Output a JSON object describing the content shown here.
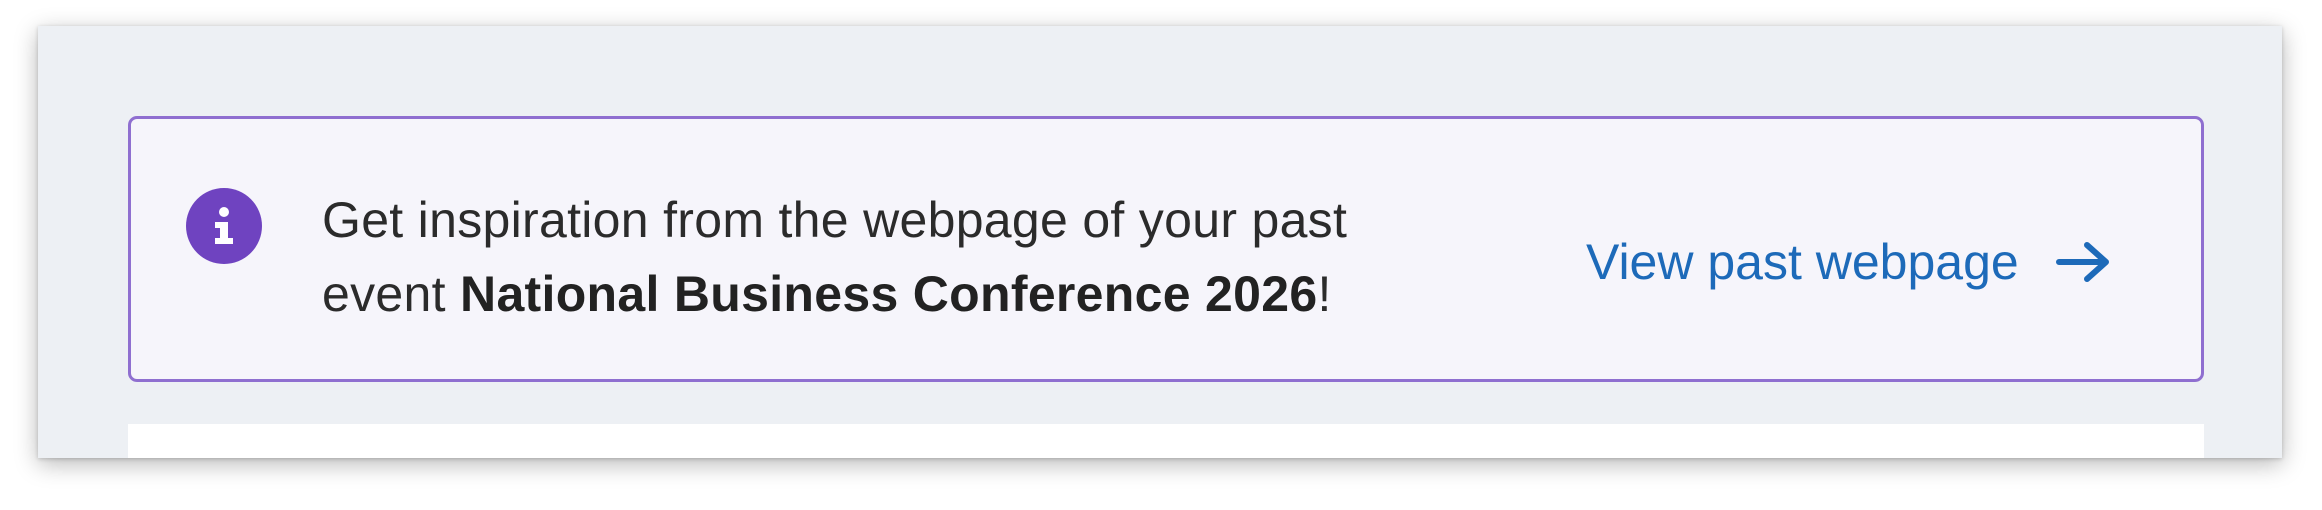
{
  "banner": {
    "icon": "info-icon",
    "message_prefix": "Get inspiration from the webpage of your past event",
    "event_name": "National Business Conference 2026",
    "message_suffix": "!",
    "link_label": "View past webpage",
    "link_icon": "arrow-right-icon",
    "colors": {
      "border": "#8f6fd0",
      "background": "#f6f5fb",
      "icon": "#6f43c0",
      "link": "#1d6ab9"
    }
  },
  "page": {
    "background": "#edf0f4"
  }
}
